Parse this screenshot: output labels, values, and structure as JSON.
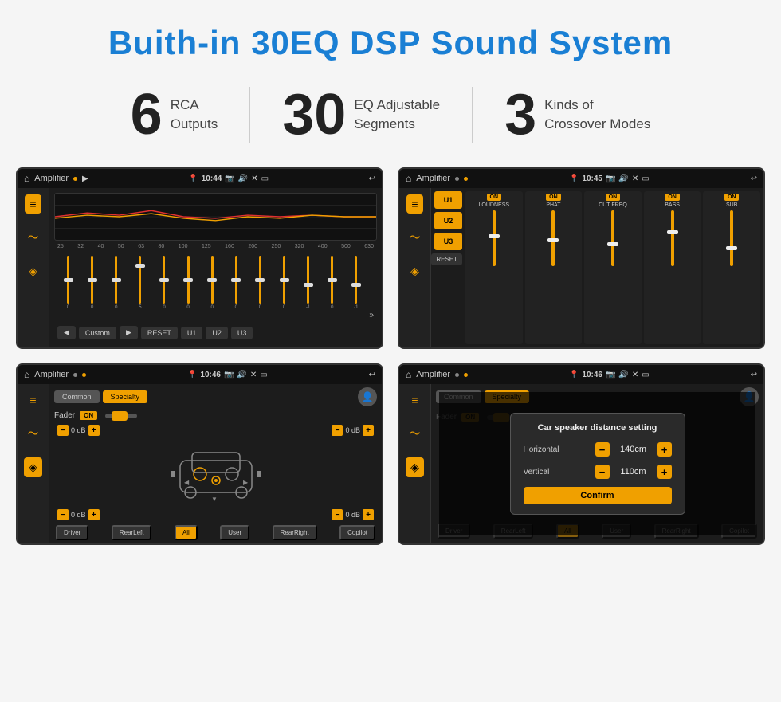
{
  "title": "Buith-in 30EQ DSP Sound System",
  "stats": [
    {
      "number": "6",
      "text": "RCA\nOutputs"
    },
    {
      "number": "30",
      "text": "EQ Adjustable\nSegments"
    },
    {
      "number": "3",
      "text": "Kinds of\nCrossover Modes"
    }
  ],
  "screens": [
    {
      "id": "eq-screen",
      "statusBar": {
        "appTitle": "Amplifier",
        "time": "10:44"
      },
      "eqFreqLabels": [
        "25",
        "32",
        "40",
        "50",
        "63",
        "80",
        "100",
        "125",
        "160",
        "200",
        "250",
        "320",
        "400",
        "500",
        "630"
      ],
      "eqSliderValues": [
        "0",
        "0",
        "0",
        "5",
        "0",
        "0",
        "0",
        "0",
        "0",
        "0",
        "-1",
        "0",
        "-1"
      ],
      "bottomButtons": [
        "◀",
        "Custom",
        "▶",
        "RESET",
        "U1",
        "U2",
        "U3"
      ]
    },
    {
      "id": "crossover-screen",
      "statusBar": {
        "appTitle": "Amplifier",
        "time": "10:45"
      },
      "channels": [
        "U1",
        "U2",
        "U3"
      ],
      "controls": [
        {
          "label": "LOUDNESS",
          "on": true
        },
        {
          "label": "PHAT",
          "on": true
        },
        {
          "label": "CUT FREQ",
          "on": true
        },
        {
          "label": "BASS",
          "on": true
        },
        {
          "label": "SUB",
          "on": true
        }
      ],
      "resetBtn": "RESET"
    },
    {
      "id": "fader-screen",
      "statusBar": {
        "appTitle": "Amplifier",
        "time": "10:46"
      },
      "tabs": [
        "Common",
        "Specialty"
      ],
      "faderLabel": "Fader",
      "faderOn": "ON",
      "dbControls": {
        "topLeft": "0 dB",
        "topRight": "0 dB",
        "bottomLeft": "0 dB",
        "bottomRight": "0 dB"
      },
      "buttons": [
        "Driver",
        "RearLeft",
        "All",
        "User",
        "RearRight",
        "Copilot"
      ]
    },
    {
      "id": "distance-screen",
      "statusBar": {
        "appTitle": "Amplifier",
        "time": "10:46"
      },
      "tabs": [
        "Common",
        "Specialty"
      ],
      "dialog": {
        "title": "Car speaker distance setting",
        "rows": [
          {
            "label": "Horizontal",
            "value": "140cm"
          },
          {
            "label": "Vertical",
            "value": "110cm"
          }
        ],
        "confirmBtn": "Confirm"
      },
      "buttons": [
        "Driver",
        "RearLeft",
        "All",
        "User",
        "RearRight",
        "Copilot"
      ]
    }
  ]
}
